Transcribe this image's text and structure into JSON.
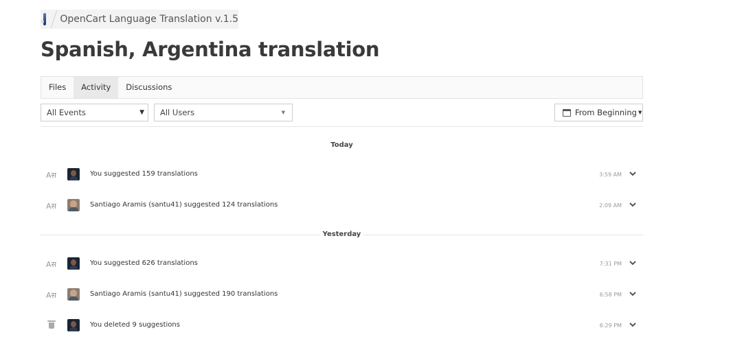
{
  "breadcrumb": {
    "project": "OpenCart Language Translation v.1.5"
  },
  "page": {
    "title": "Spanish, Argentina translation"
  },
  "tabs": [
    {
      "label": "Files"
    },
    {
      "label": "Activity",
      "active": true
    },
    {
      "label": "Discussions"
    }
  ],
  "filters": {
    "events": "All Events",
    "users": "All Users",
    "date": "From Beginning"
  },
  "days": [
    {
      "label": "Today",
      "entries": [
        {
          "type": "suggest",
          "avatar": "you",
          "message": "You suggested 159 translations",
          "time": "3:59 AM"
        },
        {
          "type": "suggest",
          "avatar": "santiago",
          "message": "Santiago Aramis (santu41) suggested 124 translations",
          "time": "2:09 AM"
        }
      ]
    },
    {
      "label": "Yesterday",
      "entries": [
        {
          "type": "suggest",
          "avatar": "you",
          "message": "You suggested 626 translations",
          "time": "7:31 PM"
        },
        {
          "type": "suggest",
          "avatar": "santiago",
          "message": "Santiago Aramis (santu41) suggested 190 translations",
          "time": "6:58 PM"
        },
        {
          "type": "delete",
          "avatar": "you",
          "message": "You deleted 9 suggestions",
          "time": "6:29 PM"
        }
      ]
    }
  ],
  "icons": {
    "suggest": "translate-icon",
    "delete": "trash-icon",
    "expand": "chevron-down-icon",
    "calendar": "calendar-icon"
  }
}
